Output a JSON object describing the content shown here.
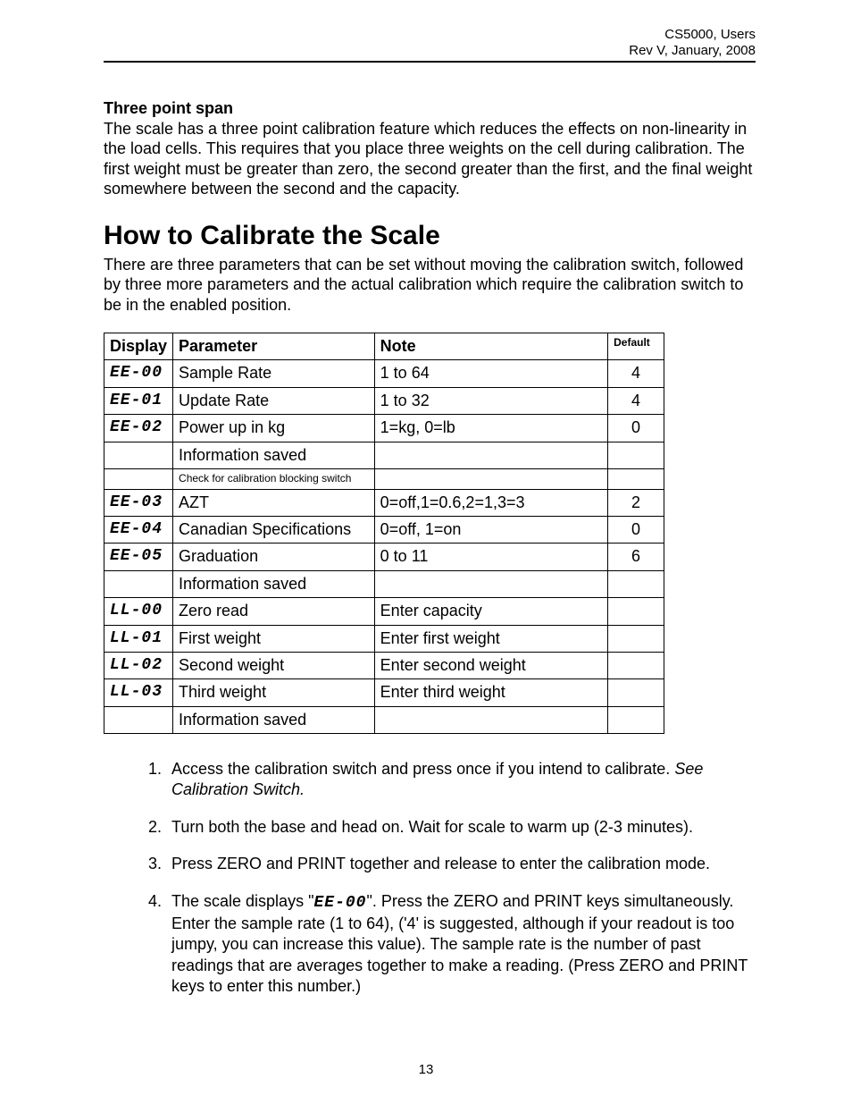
{
  "header": {
    "line1": "CS5000, Users",
    "line2": "Rev V, January, 2008"
  },
  "threePoint": {
    "heading": "Three point span",
    "body": "The scale has a three point calibration feature which reduces the effects on non-linearity in the load cells.  This requires that you place three weights on the cell during calibration. The first weight must be greater than zero, the second greater than the first, and the final weight somewhere between the second and the capacity."
  },
  "title": "How to Calibrate the Scale",
  "intro": "There are three parameters that can be set without moving the calibration switch, followed by three more parameters and the actual calibration which require the calibration switch to be in the enabled position.",
  "table": {
    "headers": {
      "display": "Display",
      "parameter": "Parameter",
      "note": "Note",
      "default": "Default"
    },
    "rows": [
      {
        "display": "EE-00",
        "seg": true,
        "parameter": "Sample Rate",
        "note": "1 to 64",
        "default": "4"
      },
      {
        "display": "EE-01",
        "seg": true,
        "parameter": "Update Rate",
        "note": "1 to 32",
        "default": "4"
      },
      {
        "display": "EE-02",
        "seg": true,
        "parameter": "Power up in kg",
        "note": "1=kg, 0=lb",
        "default": "0"
      },
      {
        "display": "",
        "seg": false,
        "parameter": "Information saved",
        "note": "",
        "default": ""
      },
      {
        "display": "",
        "seg": false,
        "parameter": "Check for calibration blocking switch",
        "small": true,
        "note": "",
        "default": ""
      },
      {
        "display": "EE-03",
        "seg": true,
        "parameter": "AZT",
        "note": "0=off,1=0.6,2=1,3=3",
        "default": "2"
      },
      {
        "display": "EE-04",
        "seg": true,
        "parameter": "Canadian Specifications",
        "note": "0=off, 1=on",
        "default": "0"
      },
      {
        "display": "EE-05",
        "seg": true,
        "parameter": "Graduation",
        "note": "0 to 11",
        "default": "6"
      },
      {
        "display": "",
        "seg": false,
        "parameter": "Information saved",
        "note": "",
        "default": ""
      },
      {
        "display": "LL-00",
        "seg": true,
        "parameter": "Zero read",
        "note": "Enter capacity",
        "default": ""
      },
      {
        "display": "LL-01",
        "seg": true,
        "parameter": "First weight",
        "note": "Enter first weight",
        "default": ""
      },
      {
        "display": "LL-02",
        "seg": true,
        "parameter": "Second weight",
        "note": "Enter second weight",
        "default": ""
      },
      {
        "display": "LL-03",
        "seg": true,
        "parameter": "Third weight",
        "note": "Enter third weight",
        "default": ""
      },
      {
        "display": "",
        "seg": false,
        "parameter": "Information saved",
        "note": "",
        "default": ""
      }
    ]
  },
  "steps": {
    "s1a": "Access the calibration switch and press once if you intend to calibrate. ",
    "s1b": "See Calibration Switch.",
    "s2": "Turn both the base and head on. Wait for scale to warm up (2-3 minutes).",
    "s3": "Press ZERO and PRINT together and release to enter the calibration mode.",
    "s4a": "The scale displays \"",
    "s4code": "EE-00",
    "s4b": "\".  Press the ZERO and PRINT keys simultaneously. Enter the sample rate (1 to 64), ('4' is suggested, although if your readout is too jumpy, you can increase this value).  The sample rate is the number of past readings that are averages together to make a reading. (Press ZERO and PRINT keys to enter this number.)"
  },
  "pageNumber": "13"
}
